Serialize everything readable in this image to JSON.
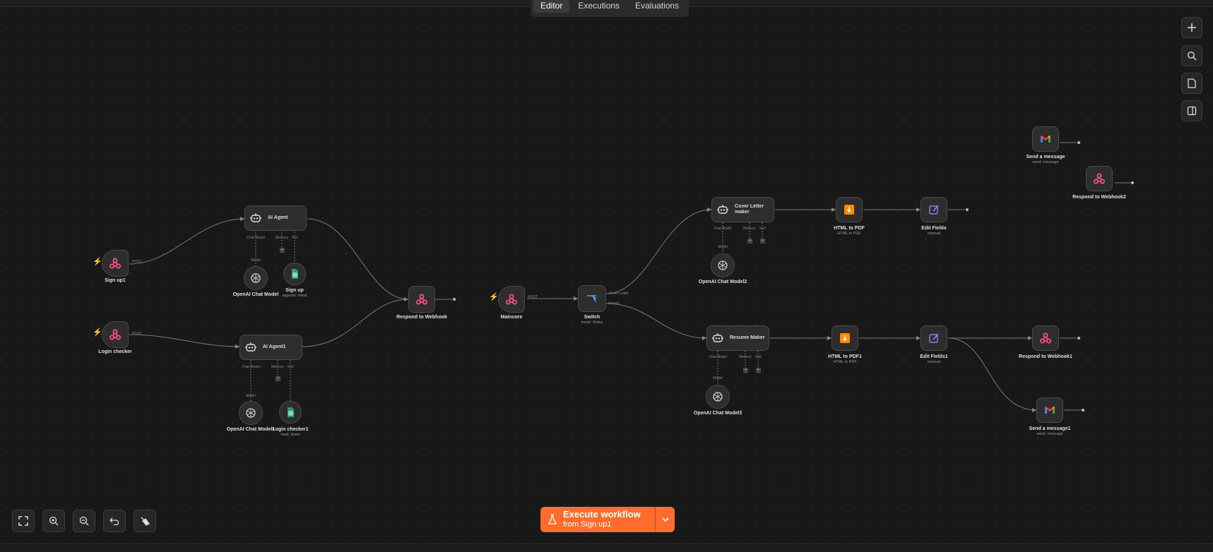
{
  "tabs": [
    "Editor",
    "Executions",
    "Evaluations"
  ],
  "nodes": [
    {
      "name": "Sign up1",
      "sub": "",
      "icon": "webhook-icon"
    },
    {
      "name": "Login checker",
      "sub": "",
      "icon": "webhook-icon"
    },
    {
      "name": "AI Agent",
      "sub": "",
      "icon": "robot-icon"
    },
    {
      "name": "AI Agent1",
      "sub": "",
      "icon": "robot-icon"
    },
    {
      "name": "OpenAI Chat Model",
      "sub": "",
      "icon": "openai-icon"
    },
    {
      "name": "Sign up",
      "sub": "append: sheet",
      "icon": "google-sheets-icon"
    },
    {
      "name": "OpenAI Chat Model1",
      "sub": "",
      "icon": "openai-icon"
    },
    {
      "name": "Login checker1",
      "sub": "read: sheet",
      "icon": "google-sheets-icon"
    },
    {
      "name": "Respond to Webhook",
      "sub": "",
      "icon": "webhook-icon"
    },
    {
      "name": "Maincore",
      "sub": "",
      "icon": "webhook-icon"
    },
    {
      "name": "Switch",
      "sub": "mode: Rules",
      "icon": "switch-icon"
    },
    {
      "name": "Cover Letter maker",
      "sub": "",
      "icon": "robot-icon"
    },
    {
      "name": "OpenAI Chat Model2",
      "sub": "",
      "icon": "openai-icon"
    },
    {
      "name": "HTML to PDF",
      "sub": "HTML to PDF",
      "icon": "html-pdf-icon"
    },
    {
      "name": "Edit Fields",
      "sub": "manual",
      "icon": "edit-icon"
    },
    {
      "name": "Resume Maker",
      "sub": "",
      "icon": "robot-icon"
    },
    {
      "name": "OpenAI Chat Model3",
      "sub": "",
      "icon": "openai-icon"
    },
    {
      "name": "HTML to PDF1",
      "sub": "HTML to PDF",
      "icon": "html-pdf-icon"
    },
    {
      "name": "Edit Fields1",
      "sub": "manual",
      "icon": "edit-icon"
    },
    {
      "name": "Respond to Webhook1",
      "sub": "",
      "icon": "webhook-icon"
    },
    {
      "name": "Send a message1",
      "sub": "send: message",
      "icon": "gmail-icon"
    },
    {
      "name": "Send a message",
      "sub": "send: message",
      "icon": "gmail-icon"
    },
    {
      "name": "Respond to Webhook2",
      "sub": "",
      "icon": "webhook-icon"
    }
  ],
  "port_labels": {
    "post": "POST",
    "chat_model": "Chat Model",
    "memory": "Memory",
    "tool": "Tool",
    "model": "Model",
    "cover_letter": "Cover Letter",
    "resume": "resume"
  },
  "execute_button": {
    "title": "Execute workflow",
    "subtitle": "from Sign up1"
  },
  "canvas_controls": [
    "zoom-to-fit",
    "zoom-in",
    "zoom-out",
    "undo",
    "tidy-up"
  ],
  "side_controls": [
    "add-node",
    "search",
    "sticky-note",
    "toggle-panel"
  ],
  "colors": {
    "accent": "#ff6d2e",
    "webhook": "#ff4f81",
    "sheets": "#21a366",
    "canvas": "#181818"
  }
}
